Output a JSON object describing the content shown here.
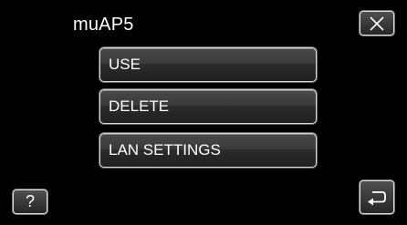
{
  "header": {
    "title": "muAP5"
  },
  "menu": {
    "items": [
      {
        "label": "USE"
      },
      {
        "label": "DELETE"
      },
      {
        "label": "LAN SETTINGS"
      }
    ]
  },
  "buttons": {
    "close_icon": "close-icon",
    "help_label": "?",
    "back_icon": "return-arrow-icon"
  },
  "colors": {
    "background": "#000000",
    "text": "#ffffff",
    "button_border": "#d9d9d9"
  }
}
